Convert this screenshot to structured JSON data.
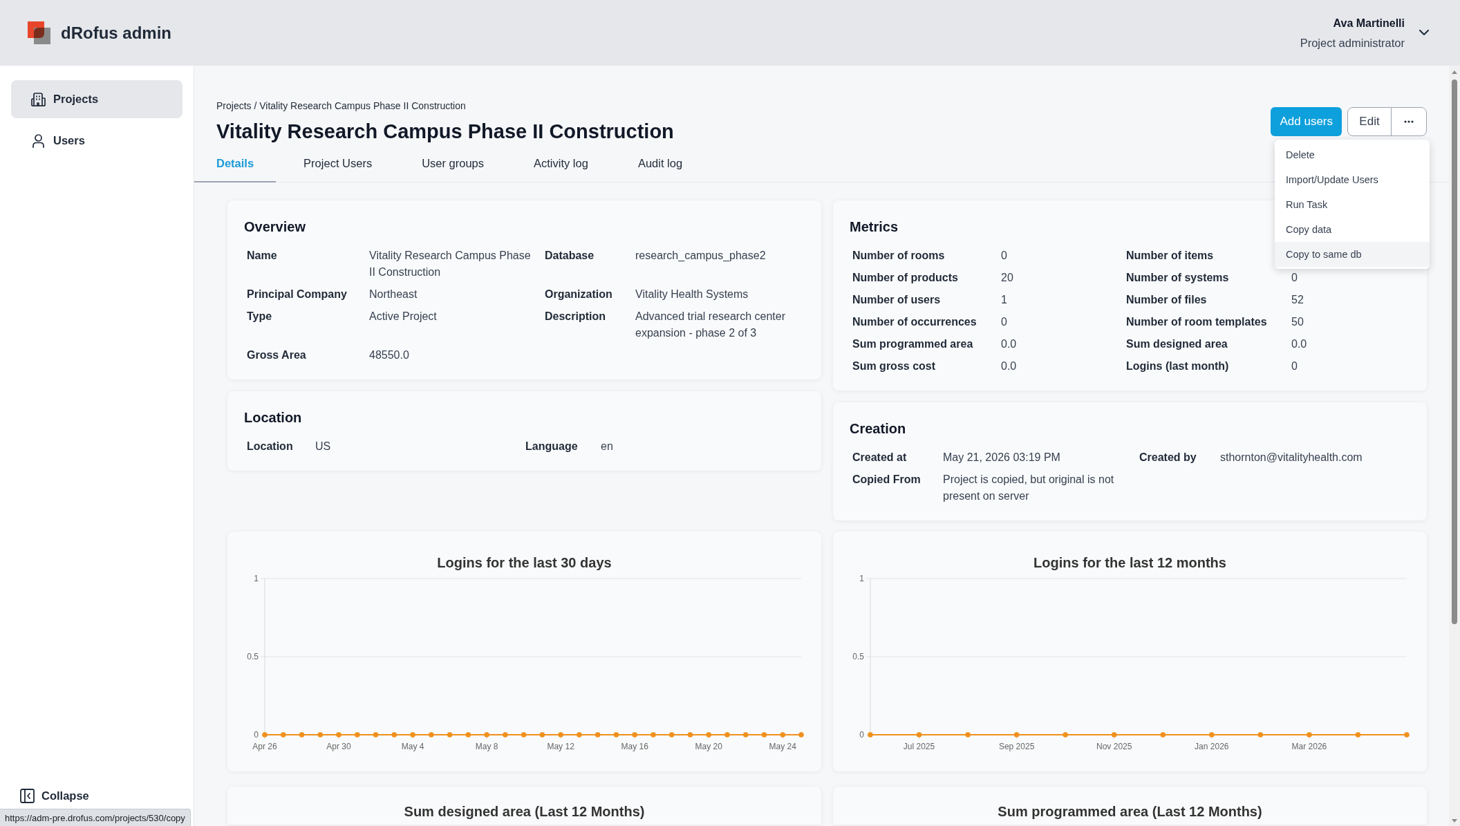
{
  "header": {
    "brand": "dRofus admin",
    "user": {
      "name": "Ava Martinelli",
      "role": "Project administrator"
    }
  },
  "sidebar": {
    "items": [
      {
        "label": "Projects",
        "selected": true
      },
      {
        "label": "Users",
        "selected": false
      }
    ],
    "collapse": "Collapse"
  },
  "page": {
    "breadcrumb": "Projects / Vitality Research Campus Phase II Construction",
    "title": "Vitality Research Campus Phase II Construction",
    "actions": {
      "primary": "Add users",
      "secondary": "Edit"
    },
    "menu": [
      {
        "label": "Delete",
        "highlighted": false
      },
      {
        "label": "Import/Update Users",
        "highlighted": false
      },
      {
        "label": "Run Task",
        "highlighted": false
      },
      {
        "label": "Copy data",
        "highlighted": false
      },
      {
        "label": "Copy to same db",
        "highlighted": true
      }
    ],
    "tabs": [
      {
        "label": "Details",
        "selected": true
      },
      {
        "label": "Project Users",
        "selected": false
      },
      {
        "label": "User groups",
        "selected": false
      },
      {
        "label": "Activity log",
        "selected": false
      },
      {
        "label": "Audit log",
        "selected": false
      }
    ]
  },
  "overview": {
    "title": "Overview",
    "fields": [
      {
        "label": "Name",
        "value": "Vitality Research Campus Phase II Construction"
      },
      {
        "label": "Database",
        "value": "research_campus_phase2"
      },
      {
        "label": "Principal Company",
        "value": "Northeast"
      },
      {
        "label": "Organization",
        "value": "Vitality Health Systems"
      },
      {
        "label": "Type",
        "value": "Active Project"
      },
      {
        "label": "Description",
        "value": "Advanced trial research center expansion - phase 2 of 3"
      },
      {
        "label": "Gross Area",
        "value": "48550.0"
      }
    ]
  },
  "location": {
    "title": "Location",
    "fields": [
      {
        "label": "Location",
        "value": "US"
      },
      {
        "label": "Language",
        "value": "en"
      }
    ]
  },
  "metrics": {
    "title": "Metrics",
    "fields": [
      {
        "label": "Number of rooms",
        "value": "0"
      },
      {
        "label": "Number of items"
      },
      {
        "label": "Number of products",
        "value": "20"
      },
      {
        "label": "Number of systems",
        "value": "0"
      },
      {
        "label": "Number of users",
        "value": "1"
      },
      {
        "label": "Number of files",
        "value": "52"
      },
      {
        "label": "Number of occurrences",
        "value": "0"
      },
      {
        "label": "Number of room templates",
        "value": "50"
      },
      {
        "label": "Sum programmed area",
        "value": "0.0"
      },
      {
        "label": "Sum designed area",
        "value": "0.0"
      },
      {
        "label": "Sum gross cost",
        "value": "0.0"
      },
      {
        "label": "Logins (last month)",
        "value": "0"
      }
    ]
  },
  "creation": {
    "title": "Creation",
    "fields": [
      {
        "label": "Created at",
        "value": "May 21, 2026 03:19 PM"
      },
      {
        "label": "Created by",
        "value": "sthornton@vitalityhealth.com"
      },
      {
        "label": "Copied From",
        "value": "Project is copied, but original is not present on server"
      }
    ]
  },
  "charts": [
    {
      "chart_data": {
        "type": "line",
        "title": "Logins for the last 30 days",
        "categories": [
          "Apr 26",
          null,
          null,
          null,
          "Apr 30",
          null,
          null,
          null,
          "May 4",
          null,
          null,
          null,
          "May 8",
          null,
          null,
          null,
          "May 12",
          null,
          null,
          null,
          "May 16",
          null,
          null,
          null,
          "May 20",
          null,
          null,
          null,
          "May 24",
          null
        ],
        "series": [
          {
            "color": "#f0901c",
            "marker": "circle",
            "values": [
              0,
              0,
              0,
              0,
              0,
              0,
              0,
              0,
              0,
              0,
              0,
              0,
              0,
              0,
              0,
              0,
              0,
              0,
              0,
              0,
              0,
              0,
              0,
              0,
              0,
              0,
              0,
              0,
              0,
              0
            ]
          }
        ],
        "ylim": [
          0,
          1
        ],
        "yticks": [
          0,
          0.5,
          1
        ]
      }
    },
    {
      "chart_data": {
        "type": "line",
        "title": "Logins for the last 12 months",
        "categories": [
          null,
          "Jul 2025",
          null,
          "Sep 2025",
          null,
          "Nov 2025",
          null,
          "Jan 2026",
          null,
          "Mar 2026",
          null,
          null
        ],
        "series": [
          {
            "color": "#f0901c",
            "marker": "circle",
            "values": [
              0,
              0,
              0,
              0,
              0,
              0,
              0,
              0,
              0,
              0,
              0,
              0
            ]
          }
        ],
        "ylim": [
          0,
          1
        ],
        "yticks": [
          0,
          0.5,
          1
        ]
      }
    }
  ],
  "more_charts": [
    {
      "title": "Sum designed area (Last 12 Months)"
    },
    {
      "title": "Sum programmed area (Last 12 Months)"
    }
  ],
  "link_preview": "https://adm-pre.drofus.com/projects/530/copy"
}
